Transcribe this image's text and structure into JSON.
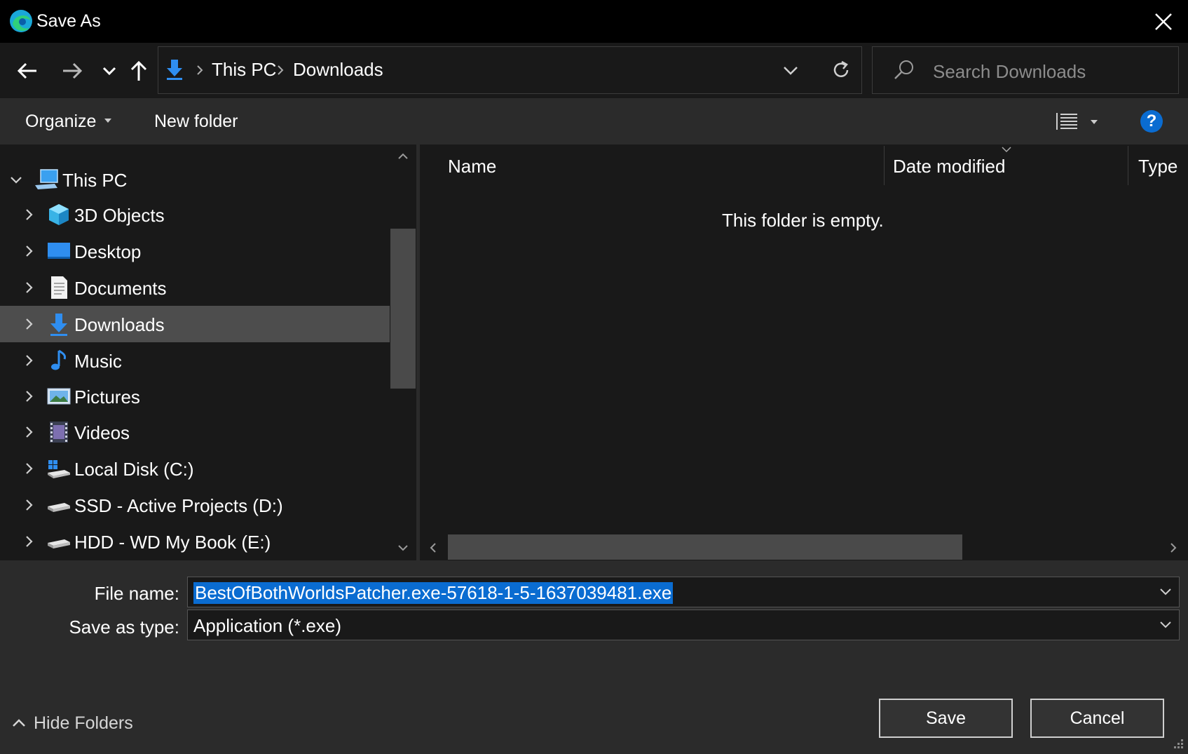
{
  "window": {
    "title": "Save As",
    "app_icon": "edge-icon",
    "close_icon": "close-icon"
  },
  "nav": {
    "back_icon": "back-arrow-icon",
    "forward_icon": "forward-arrow-icon",
    "recent_icon": "chevron-down-icon",
    "up_icon": "up-arrow-icon",
    "breadcrumb": [
      "This PC",
      "Downloads"
    ],
    "refresh_icon": "refresh-icon",
    "search_placeholder": "Search Downloads"
  },
  "toolbar": {
    "organize": "Organize",
    "new_folder": "New folder",
    "help": "?"
  },
  "tree": [
    {
      "label": "This PC",
      "icon": "computer-icon",
      "expanded": true,
      "level": 0
    },
    {
      "label": "3D Objects",
      "icon": "cube-icon",
      "level": 1
    },
    {
      "label": "Desktop",
      "icon": "desktop-icon",
      "level": 1
    },
    {
      "label": "Documents",
      "icon": "document-icon",
      "level": 1
    },
    {
      "label": "Downloads",
      "icon": "download-icon",
      "level": 1,
      "selected": true
    },
    {
      "label": "Music",
      "icon": "music-icon",
      "level": 1
    },
    {
      "label": "Pictures",
      "icon": "picture-icon",
      "level": 1
    },
    {
      "label": "Videos",
      "icon": "video-icon",
      "level": 1
    },
    {
      "label": "Local Disk (C:)",
      "icon": "system-drive-icon",
      "level": 1
    },
    {
      "label": "SSD - Active Projects (D:)",
      "icon": "drive-icon",
      "level": 1
    },
    {
      "label": "HDD - WD My Book (E:)",
      "icon": "drive-icon",
      "level": 1
    }
  ],
  "columns": [
    "Name",
    "Date modified",
    "Type"
  ],
  "empty_message": "This folder is empty.",
  "form": {
    "file_name_label": "File name:",
    "file_name_value": "BestOfBothWorldsPatcher.exe-57618-1-5-1637039481.exe",
    "type_label": "Save as type:",
    "type_value": "Application (*.exe)"
  },
  "footer": {
    "hide_folders": "Hide Folders",
    "save": "Save",
    "cancel": "Cancel"
  },
  "colors": {
    "accent": "#0a6cd1",
    "selection": "#4d4d4d",
    "background": "#191919",
    "panel": "#2b2b2b"
  }
}
